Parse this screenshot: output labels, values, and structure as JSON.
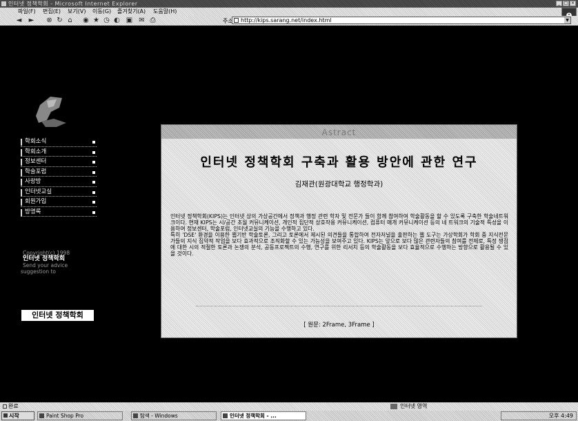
{
  "window": {
    "title": "인터넷 정책학회 - Microsoft Internet Explorer"
  },
  "menu": [
    "파일(F)",
    "편집(E)",
    "보기(V)",
    "이동(G)",
    "즐겨찾기(A)",
    "도움말(H)"
  ],
  "address": {
    "label": "주소",
    "url": "http://kips.sarang.net/index.html"
  },
  "sidebar": {
    "items": [
      {
        "label": "학회소식"
      },
      {
        "label": "학회소개"
      },
      {
        "label": "정보센터"
      },
      {
        "label": "학술포럼"
      },
      {
        "label": "사랑방"
      },
      {
        "label": "인터넷교실"
      },
      {
        "label": "회원가입"
      },
      {
        "label": "방명록"
      }
    ],
    "copyright_line1": "Copyright(c) 1998",
    "copyright_org": "인터넷 정책학회",
    "copyright_line3": "Send your advice",
    "copyright_link": "suggestion to",
    "stamp_text": "인터넷 정책학회"
  },
  "abstract": {
    "header": "Astract",
    "title": "인터넷 정책학회 구축과 활용 방안에 관한 연구",
    "author": "김재관(원광대학교 행정학과)",
    "paragraph1": "인터넷 정책학회(KIPS)는 인터넷 상의 가상공간에서 정책과 행정 관련 학자 및 전문가 들이 함께 참여하여 학술활동을 할 수 있도록 구축한 학술네트워크이다. 현재 KIPS는 시/공간 초월 커뮤니케이션, 개인적 집단적 상호작용 커뮤니케이션, 컴퓨터 매개 커뮤니케이션 등의 네 트워크의 기술적 특성을 이용하여 정보센터, 학술포럼, 인터넷교실의 기능을 수행하고 있다.",
    "paragraph2": "특히 'DSE' 환경을 이용한 웹기반 학술토론, 그리고 토론에서 제시된 의견들을 통합하여 전자저널을 출판하는 웹 도구는 가상학회가 학회 중 지식전문가들의 지식 집약적 작업을 보다 효과적으로 조직화할 수 있는 가능성을 보여주고 있다. KIPS는 앞으로 보다 많은 관련자들의 참여를 전제로, 특정 쟁점에 대한 시의 적절한 토론과 논쟁의 분석, 공동프로젝트의 수행, 연구를 위한 리서치 등의 학술활동을 보다 효율적으로 수행하는 방향으로 활용될 수 있을 것이다.",
    "footer": "[ 원문: 2Frame, 3Frame ]"
  },
  "statusbar": {
    "status": "완료",
    "zone": "인터넷 영역"
  },
  "taskbar": {
    "start": "시작",
    "tasks": [
      {
        "label": "Paint Shop Pro"
      },
      {
        "label": "탐색 - Windows"
      },
      {
        "label": "인터넷 정책학회 - ..."
      }
    ],
    "clock": "오후 4:49"
  }
}
